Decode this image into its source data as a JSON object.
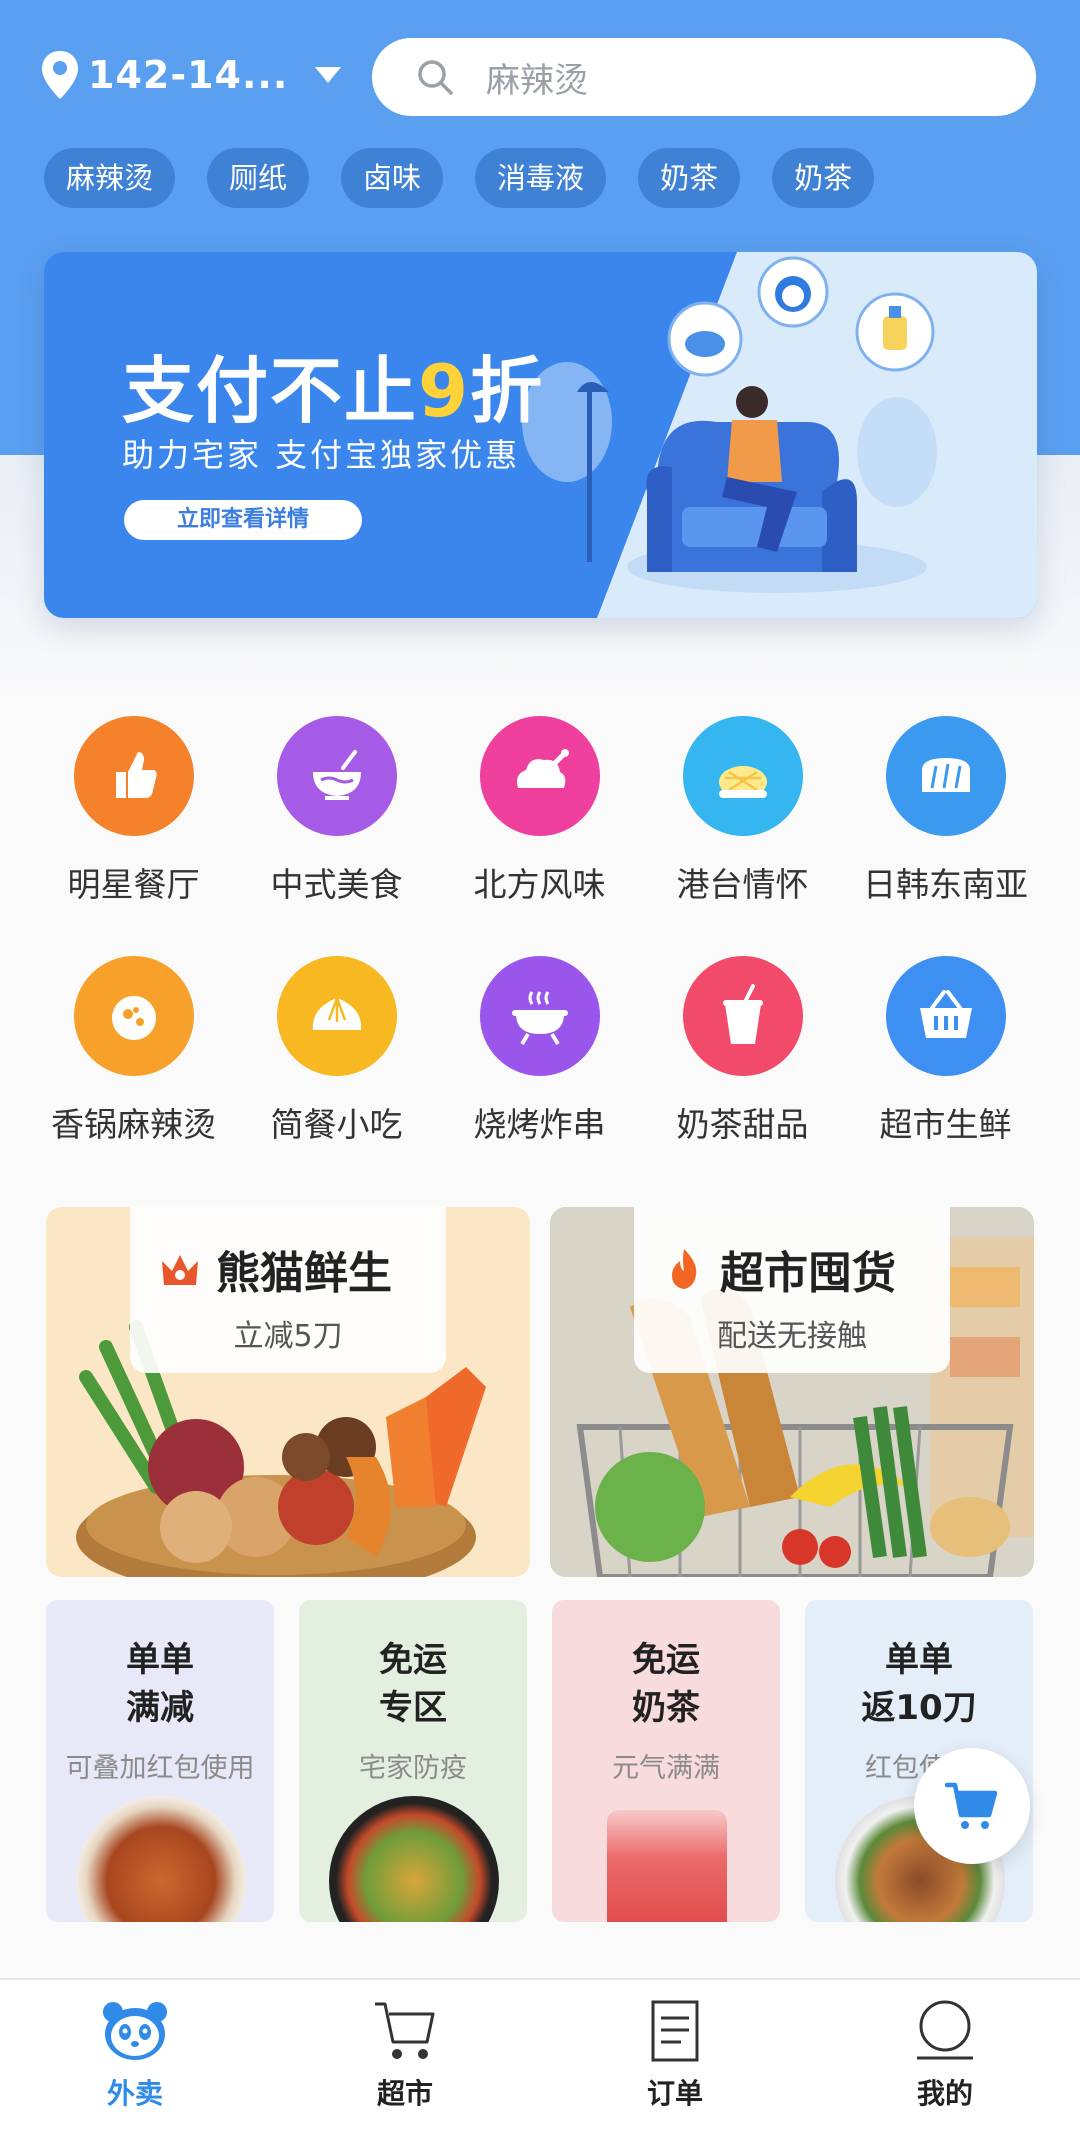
{
  "header": {
    "location": "142-14...",
    "search_placeholder": "麻辣烫"
  },
  "hot_tags": [
    "麻辣烫",
    "厕纸",
    "卤味",
    "消毒液",
    "奶茶",
    "奶茶"
  ],
  "banner": {
    "title_prefix": "支付不止",
    "title_highlight": "9",
    "title_suffix": "折",
    "subtitle": "助力宅家 支付宝独家优惠",
    "cta": "立即查看详情"
  },
  "categories": [
    {
      "label": "明星餐厅",
      "icon": "thumbs-up-icon",
      "color": "#f5822b"
    },
    {
      "label": "中式美食",
      "icon": "bowl-icon",
      "color": "#a55be6"
    },
    {
      "label": "北方风味",
      "icon": "chicken-icon",
      "color": "#ee3f9d"
    },
    {
      "label": "港台情怀",
      "icon": "pineapple-bun-icon",
      "color": "#35b6f0"
    },
    {
      "label": "日韩东南亚",
      "icon": "bread-icon",
      "color": "#3b9af0"
    },
    {
      "label": "香锅麻辣烫",
      "icon": "hotpot-icon",
      "color": "#f7a12a"
    },
    {
      "label": "简餐小吃",
      "icon": "bun-icon",
      "color": "#f8b822"
    },
    {
      "label": "烧烤炸串",
      "icon": "grill-icon",
      "color": "#9a55ea"
    },
    {
      "label": "奶茶甜品",
      "icon": "drink-icon",
      "color": "#f24a6a"
    },
    {
      "label": "超市生鲜",
      "icon": "basket-icon",
      "color": "#3d90f2"
    }
  ],
  "promos": [
    {
      "title": "熊猫鲜生",
      "sub": "立减5刀",
      "icon": "crown-icon",
      "accent": "#e8562b"
    },
    {
      "title": "超市囤货",
      "sub": "配送无接触",
      "icon": "flame-icon",
      "accent": "#f26522"
    }
  ],
  "small_cards": [
    {
      "line1": "单单",
      "line2": "满减",
      "sub": "可叠加红包使用",
      "bg": "#e7e8f8"
    },
    {
      "line1": "免运",
      "line2": "专区",
      "sub": "宅家防疫",
      "bg": "#e3efdf"
    },
    {
      "line1": "免运",
      "line2": "奶茶",
      "sub": "元气满满",
      "bg": "#f8dbdd"
    },
    {
      "line1": "单单",
      "line2": "返10刀",
      "sub": "红包使用",
      "bg": "#e3eef9"
    }
  ],
  "tabs": [
    {
      "label": "外卖",
      "icon": "panda-icon"
    },
    {
      "label": "超市",
      "icon": "cart-icon"
    },
    {
      "label": "订单",
      "icon": "order-icon"
    },
    {
      "label": "我的",
      "icon": "profile-icon"
    }
  ],
  "colors": {
    "primary": "#5b9ff0",
    "active_tab": "#2f8ae8"
  }
}
